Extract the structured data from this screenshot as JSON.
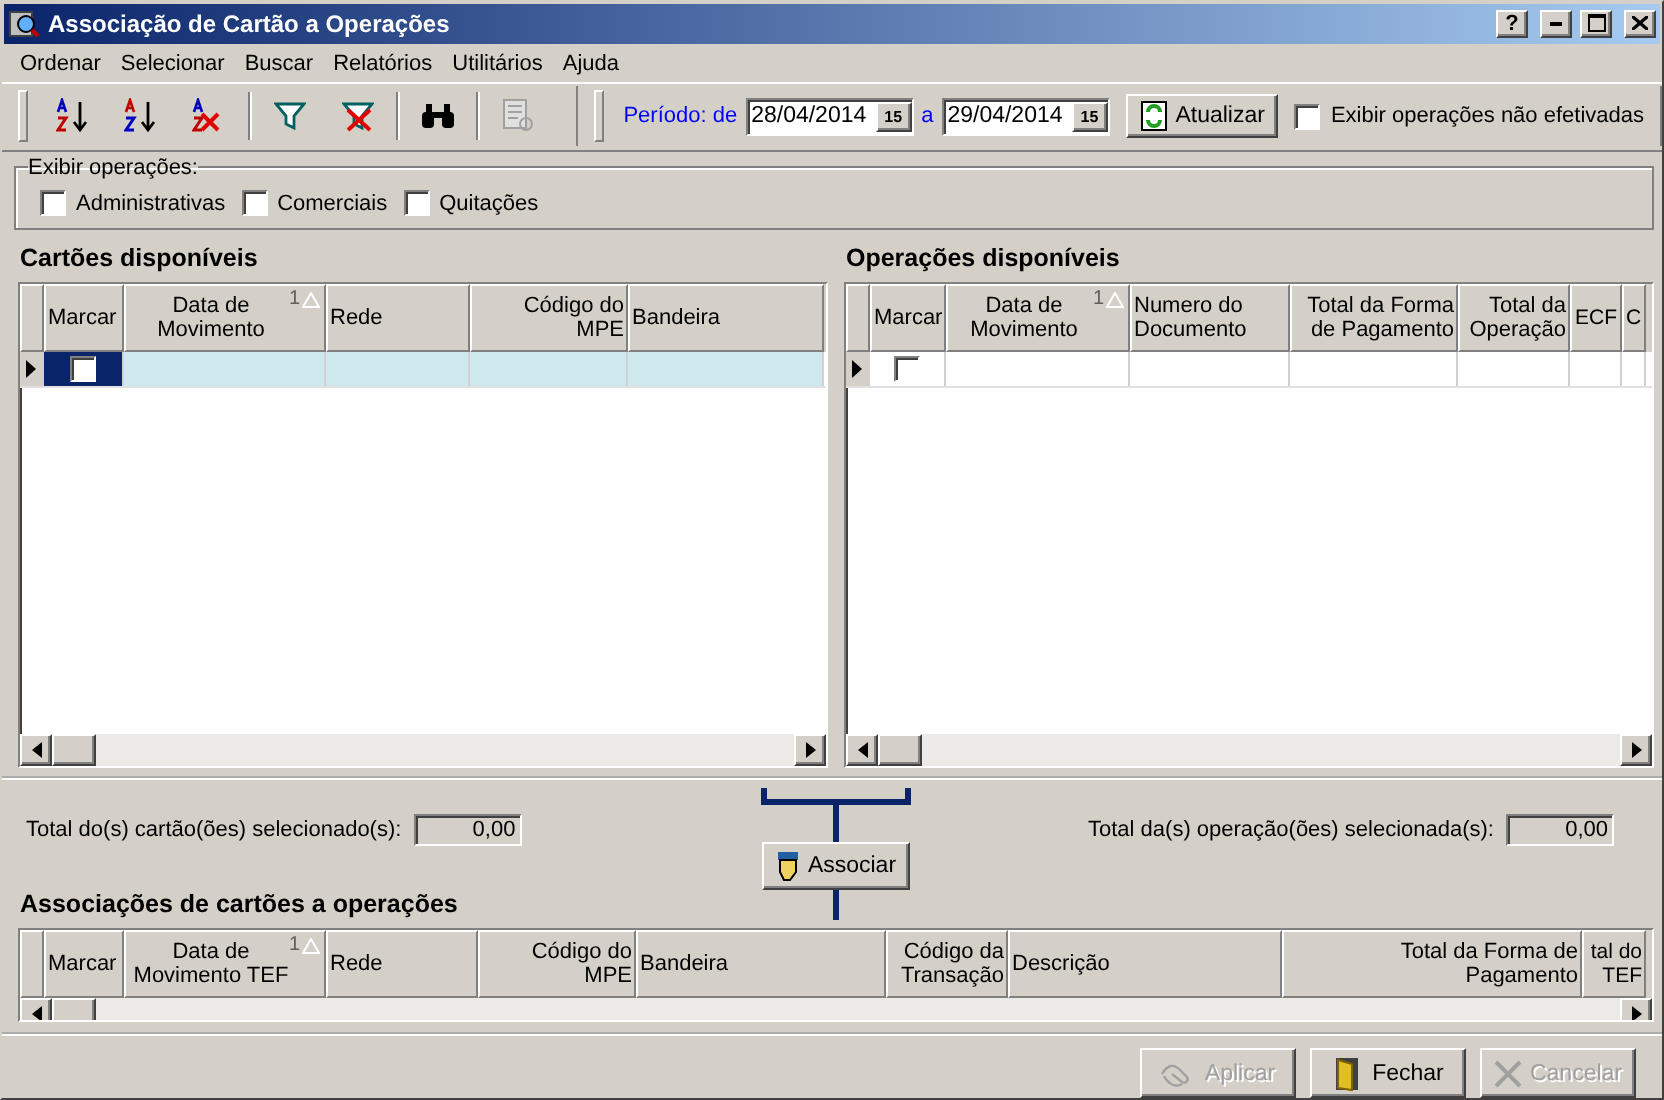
{
  "window": {
    "title": "Associação de Cartão a Operações",
    "controls": [
      {
        "kind": "help",
        "label": "?"
      },
      {
        "kind": "minimize"
      },
      {
        "kind": "maximize"
      },
      {
        "kind": "close"
      }
    ]
  },
  "menu": [
    {
      "label": "Ordenar"
    },
    {
      "label": "Selecionar"
    },
    {
      "label": "Buscar"
    },
    {
      "label": "Relatórios"
    },
    {
      "label": "Utilitários"
    },
    {
      "label": "Ajuda"
    }
  ],
  "toolbar": [
    {
      "kind": "sort-asc",
      "disabled": false
    },
    {
      "kind": "sort-desc",
      "disabled": false
    },
    {
      "kind": "sort-clear",
      "disabled": false
    },
    {
      "kind": "separator"
    },
    {
      "kind": "filter",
      "disabled": false
    },
    {
      "kind": "filter-clear",
      "disabled": false
    },
    {
      "kind": "separator"
    },
    {
      "kind": "find",
      "disabled": false
    },
    {
      "kind": "separator"
    },
    {
      "kind": "report",
      "disabled": true
    }
  ],
  "period": {
    "label_from": "Período: de",
    "from": "28/04/2014",
    "from_calendar": "15",
    "label_to": "a",
    "to": "29/04/2014",
    "to_calendar": "15",
    "refresh": "Atualizar",
    "show_unconfirmed": {
      "label": "Exibir operações não efetivadas",
      "checked": false
    }
  },
  "filter_group": {
    "title": "Exibir operações:",
    "options": [
      {
        "label": "Administrativas",
        "checked": false
      },
      {
        "label": "Comerciais",
        "checked": false
      },
      {
        "label": "Quitações",
        "checked": false
      }
    ]
  },
  "cards_panel": {
    "title": "Cartões disponíveis",
    "columns": [
      {
        "label": "Marcar"
      },
      {
        "label": "Data de Movimento",
        "sort_mark": "1"
      },
      {
        "label": "Rede"
      },
      {
        "label": "Código do MPE"
      },
      {
        "label": "Bandeira"
      }
    ],
    "rows": [
      {
        "checked": false,
        "selected": true
      }
    ]
  },
  "operations_panel": {
    "title": "Operações disponíveis",
    "columns": [
      {
        "label": "Marcar"
      },
      {
        "label": "Data de Movimento",
        "sort_mark": "1"
      },
      {
        "label": "Numero do Documento"
      },
      {
        "label": "Total da Forma de Pagamento"
      },
      {
        "label": "Total da Operação"
      },
      {
        "label": "ECF"
      },
      {
        "label": "C"
      }
    ],
    "rows": [
      {
        "checked": false,
        "selected": false
      }
    ]
  },
  "totals": {
    "cards_label": "Total do(s) cartão(ões) selecionado(s):",
    "cards_value": "0,00",
    "operations_label": "Total da(s) operação(ões) selecionada(s):",
    "operations_value": "0,00"
  },
  "associate_button": {
    "label": "Associar"
  },
  "associations_panel": {
    "title": "Associações de cartões a operações",
    "columns": [
      {
        "label": "Marcar"
      },
      {
        "label": "Data de Movimento TEF",
        "sort_mark": "1"
      },
      {
        "label": "Rede"
      },
      {
        "label": "Código do MPE"
      },
      {
        "label": "Bandeira"
      },
      {
        "label": "Código da Transação"
      },
      {
        "label": "Descrição"
      },
      {
        "label": "Total da Forma de Pagamento"
      },
      {
        "label": "tal do TEF"
      }
    ]
  },
  "footer_buttons": [
    {
      "kind": "apply",
      "label": "Aplicar",
      "disabled": true
    },
    {
      "kind": "close",
      "label": "Fechar",
      "disabled": false
    },
    {
      "kind": "cancel",
      "label": "Cancelar",
      "disabled": true
    }
  ]
}
